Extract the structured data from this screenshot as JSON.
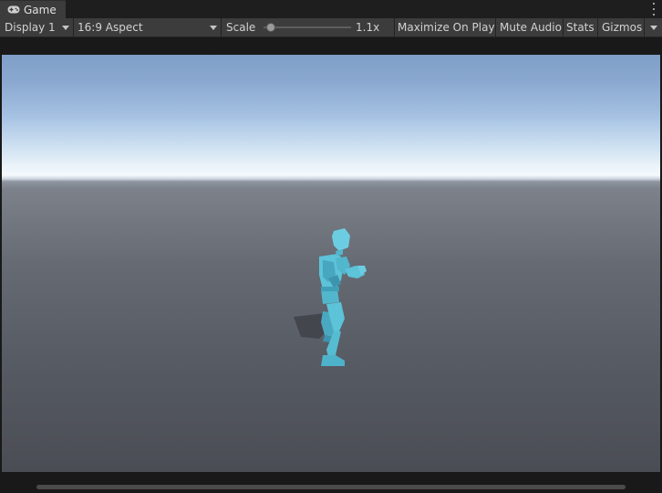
{
  "window": {
    "tab_label": "Game",
    "tab_icon": "gamepad-icon",
    "menu_icon": "kebab-menu-icon"
  },
  "toolbar": {
    "display": "Display 1",
    "aspect": "16:9 Aspect",
    "scale_label": "Scale",
    "scale_value": "1.1x",
    "scale_slider_fraction": 0.1,
    "maximize_on_play": "Maximize On Play",
    "mute_audio": "Mute Audio",
    "stats": "Stats",
    "gizmos": "Gizmos"
  },
  "colors": {
    "editor_bg": "#191919",
    "toolbar_bg": "#3c3c3c",
    "character": "#5cc3d9"
  }
}
